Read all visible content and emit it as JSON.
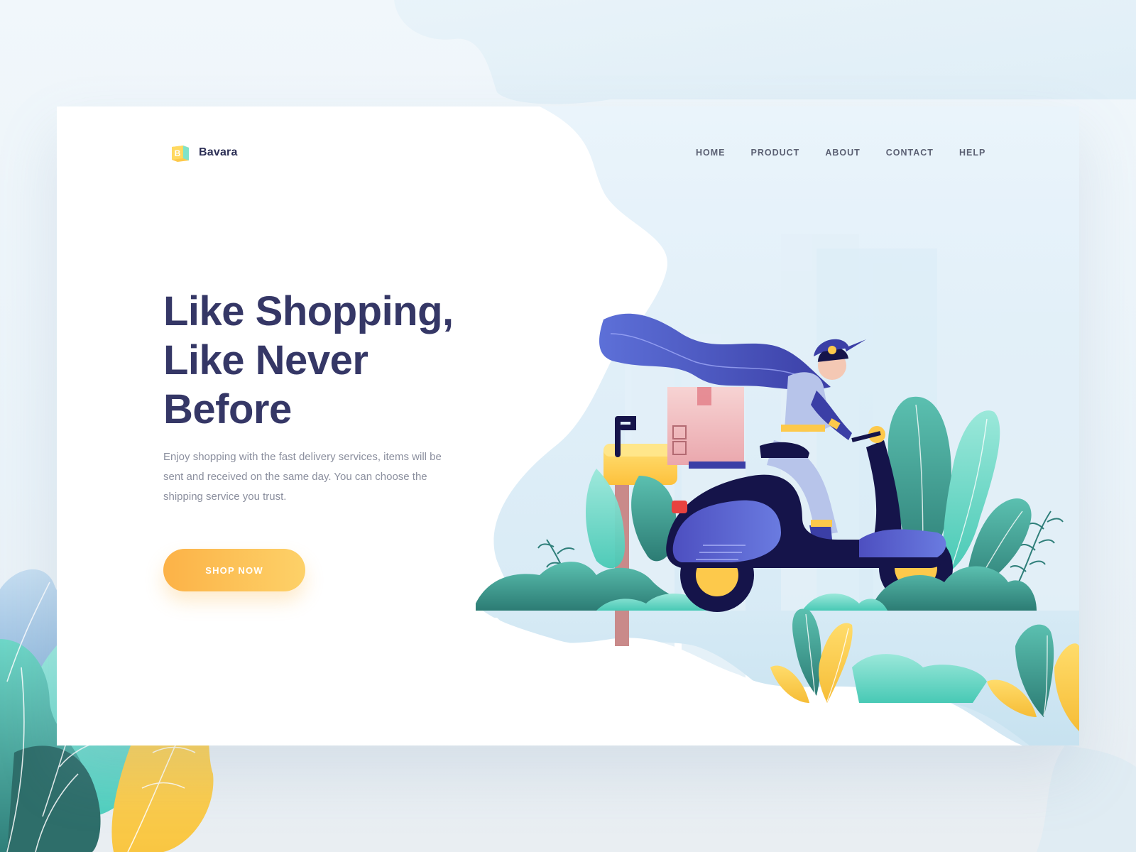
{
  "brand": {
    "name": "Bavara",
    "logo_letter": "B"
  },
  "nav": {
    "items": [
      {
        "label": "HOME"
      },
      {
        "label": "PRODUCT"
      },
      {
        "label": "ABOUT"
      },
      {
        "label": "CONTACT"
      },
      {
        "label": "HELP"
      }
    ]
  },
  "hero": {
    "title_lines": [
      "Like Shopping,",
      "Like Never",
      "Before"
    ],
    "description": "Enjoy shopping with the fast delivery services, items will be sent and received on the same day. You can choose the shipping service you trust.",
    "cta_label": "SHOP NOW"
  },
  "colors": {
    "title": "#353766",
    "body_text": "#8b8f9e",
    "nav_text": "#5b6073",
    "cta_gradient_start": "#fcb247",
    "cta_gradient_end": "#fdd168",
    "scooter": "#3b3fa6",
    "leaf_teal": "#3f9a8c",
    "leaf_yellow": "#fdc94b"
  },
  "illustration": {
    "subject": "delivery-rider-on-scooter",
    "elements": [
      "scarf",
      "parcel-box",
      "mailbox",
      "plants",
      "city-buildings"
    ]
  }
}
